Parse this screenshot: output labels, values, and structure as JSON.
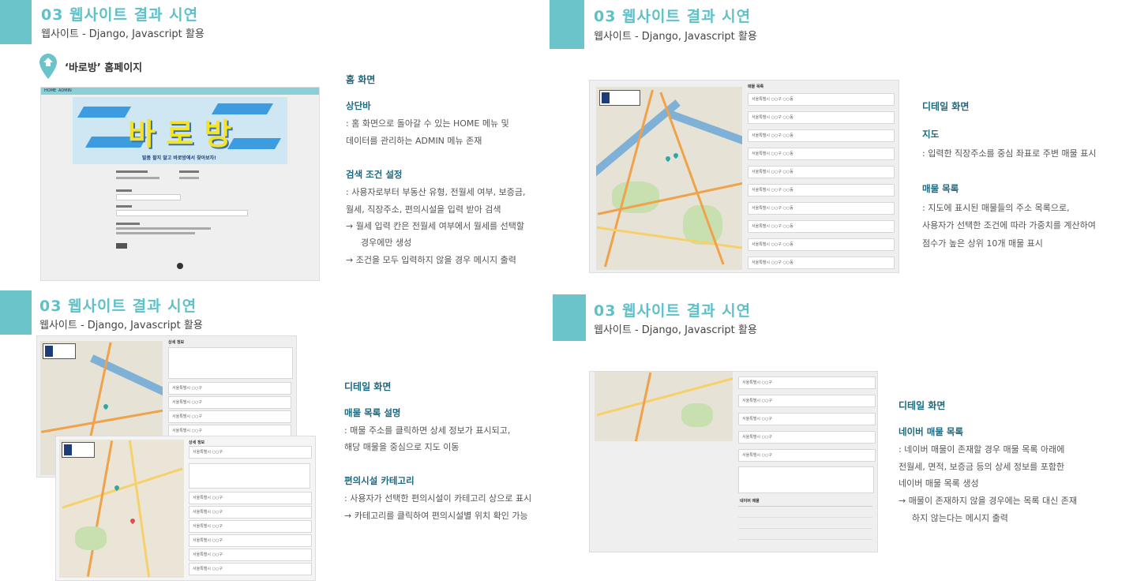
{
  "sections": [
    {
      "title": "03 웹사이트 결과 시연",
      "subtitle": "웹사이트  -  Django, Javascript 활용"
    },
    {
      "title": "03 웹사이트 결과 시연",
      "subtitle": "웹사이트  -  Django, Javascript 활용"
    },
    {
      "title": "03 웹사이트 결과 시연",
      "subtitle": "웹사이트  -  Django, Javascript 활용"
    },
    {
      "title": "03 웹사이트 결과 시연",
      "subtitle": "웹사이트  -  Django, Javascript 활용"
    }
  ],
  "homepage_label": "‘바로방’ 홈페이지",
  "home_screenshot": {
    "nav": [
      "HOME",
      "ADMIN"
    ],
    "banner_text": "바 로 방",
    "banner_caption": "발품 팔지 말고 바로방에서 찾아보자!"
  },
  "home_desc": {
    "heading": "홈 화면",
    "sub1": "상단바",
    "sub1_lines": [
      ": 홈 화면으로 돌아갈 수 있는 HOME 메뉴 및",
      "데이터를 관리하는 ADMIN 메뉴 존재"
    ],
    "sub2": "검색 조건 설정",
    "sub2_lines": [
      ": 사용자로부터 부동산 유형, 전월세 여부, 보증금,",
      "월세, 직장주소, 편의시설을 입력 받아 검색",
      "→  월세 입력 칸은 전월세 여부에서 월세를 선택할",
      "경우에만 생성",
      "→  조건을 모두 입력하지 않을 경우 메시지 출력"
    ]
  },
  "detail_desc_1": {
    "heading": "디테일 화면",
    "sub1": "지도",
    "sub1_lines": [
      ": 입력한 직장주소를 중심 좌표로 주변 매물 표시"
    ],
    "sub2": "매물 목록",
    "sub2_lines": [
      ": 지도에 표시된 매물들의 주소 목록으로,",
      "사용자가 선택한 조건에 따라 가중치를 계산하여",
      "점수가 높은 상위 10개 매물 표시"
    ]
  },
  "detail_desc_2": {
    "heading": "디테일 화면",
    "sub1": "매물 목록 설명",
    "sub1_lines": [
      ": 매물 주소를 클릭하면 상세 정보가 표시되고,",
      "해당 매물을 중심으로 지도 이동"
    ],
    "sub2": "편의시설 카테고리",
    "sub2_lines": [
      ": 사용자가 선택한 편의시설이 카테고리 상으로 표시",
      "→  카테고리를 클릭하여 편의시설별 위치 확인 가능"
    ]
  },
  "detail_desc_3": {
    "heading": "디테일 화면",
    "sub1": "네이버 매물 목록",
    "sub1_lines": [
      ": 네이버 매물이 존재할 경우 매물 목록 아래에",
      "전월세, 면적, 보증금 등의 상세 정보를 포함한",
      "네이버 매물 목록 생성",
      "→  매물이 존재하지 않을 경우에는 목록 대신 존재",
      "하지 않는다는 메시지 출력"
    ]
  },
  "list_headers": [
    "매물 목록",
    "상세 정보",
    "네이버 매물"
  ],
  "colors": {
    "accent": "#6cc4cb",
    "title": "#5ec0c8",
    "text_head": "#1c6a82"
  }
}
